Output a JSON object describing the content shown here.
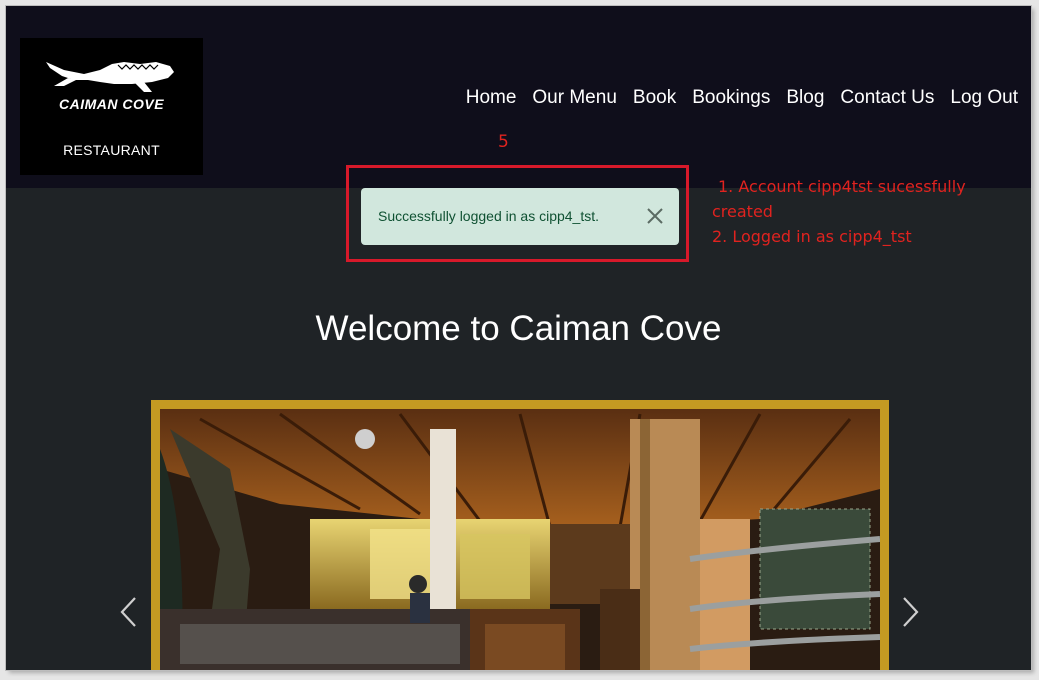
{
  "brand": {
    "name": "CAIMAN COVE",
    "tagline": "RESTAURANT",
    "logo_icon": "crocodile-logo-icon"
  },
  "nav": {
    "items": [
      {
        "label": "Home"
      },
      {
        "label": "Our Menu"
      },
      {
        "label": "Book"
      },
      {
        "label": "Bookings"
      },
      {
        "label": "Blog"
      },
      {
        "label": "Contact Us"
      },
      {
        "label": "Log Out"
      }
    ]
  },
  "alert": {
    "message": "Successfully logged in as cipp4_tst.",
    "close_icon": "close-icon"
  },
  "annotations": {
    "step_number": "5",
    "note_line1": "1. Account cipp4tst sucessfully",
    "note_line2": "created",
    "note_line3": "2. Logged in as cipp4_tst"
  },
  "main": {
    "heading": "Welcome to Caiman Cove"
  },
  "carousel": {
    "prev_icon": "chevron-left-icon",
    "next_icon": "chevron-right-icon"
  },
  "colors": {
    "page_bg": "#1f2326",
    "navbar_bg": "#0f0e1b",
    "alert_bg": "#d1e7dd",
    "alert_text": "#0f5132",
    "carousel_border": "#c49a22",
    "annotation_red": "#e0231f"
  }
}
